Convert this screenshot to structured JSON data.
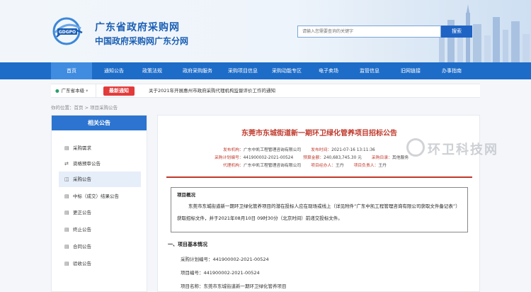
{
  "header": {
    "logo_text": "GDGPO",
    "title": "广东省政府采购网",
    "subtitle": "中国政府采购网广东分网",
    "search_placeholder": "请输入您需要查询的关键字",
    "search_button": "搜索"
  },
  "nav": {
    "items": [
      "首页",
      "通知公告",
      "政策法规",
      "政府采购服务",
      "采购项目信息",
      "采购动能专区",
      "电子卖场",
      "监管信息",
      "旧网链接",
      "办事指南"
    ],
    "active_index": 0
  },
  "notice": {
    "location": "广东省本级",
    "badge": "最新通知",
    "text": "关于2021年开展惠州市政府采购代理机构监督评价工作的通知"
  },
  "breadcrumb": "你的位置：首页 > 项目采购公告",
  "sidebar": {
    "title": "相关公告",
    "items": [
      {
        "label": "采购需求",
        "icon": "document-icon"
      },
      {
        "label": "资格预审公告",
        "icon": "exchange-icon"
      },
      {
        "label": "采购公告",
        "icon": "megaphone-icon"
      },
      {
        "label": "中标（成交）结果公告",
        "icon": "document-icon"
      },
      {
        "label": "更正公告",
        "icon": "document-icon"
      },
      {
        "label": "终止公告",
        "icon": "document-icon"
      },
      {
        "label": "合同公告",
        "icon": "document-icon"
      },
      {
        "label": "验收公告",
        "icon": "document-icon"
      }
    ],
    "active_index": 2
  },
  "article": {
    "title": "东莞市东城街道新一期环卫绿化管养项目招标公告",
    "meta": {
      "publisher_label": "发布机构：",
      "publisher": "广东中凯工程管理咨询有限公司",
      "time_label": "发布时间：",
      "time": "2021-07-16 13:11:36",
      "plan_label": "采购计划编号：",
      "plan_no": "441900002-2021-00524",
      "budget_label": "预算金额：",
      "budget": "240,683,745.30 元",
      "project_type_label": "采购目录：",
      "project_type": "其他服务",
      "agent_label": "代理机构：",
      "agent": "广东中凯工程管理咨询有限公司",
      "manager_label": "项目经办人：",
      "manager": "王丹",
      "owner_label": "项目负责人：",
      "owner": "王丹"
    },
    "overview_title": "项目概况",
    "overview_body": "东莞市东城街道新一期环卫绿化管养项目的潜在投标人应在现场或线上（详见附件“广东中凯工程管理咨询有限公司获取文件备记表”）获取招标文件，并于2021年08月10日 09时30分（北京时间）前递交投标文件。",
    "section1_title": "一、项目基本情况",
    "fields": [
      "采购计划编号：441900002-2021-00524",
      "项目编号：441900002-2021-00524",
      "项目名称：东莞市东城街道新一期环卫绿化管养项目"
    ]
  },
  "watermark": "环卫科技网",
  "colors": {
    "nav_blue": "#1d6cc8",
    "accent_red": "#c0392b",
    "badge_red": "#e23b3b",
    "title_blue": "#1a5fb4"
  }
}
